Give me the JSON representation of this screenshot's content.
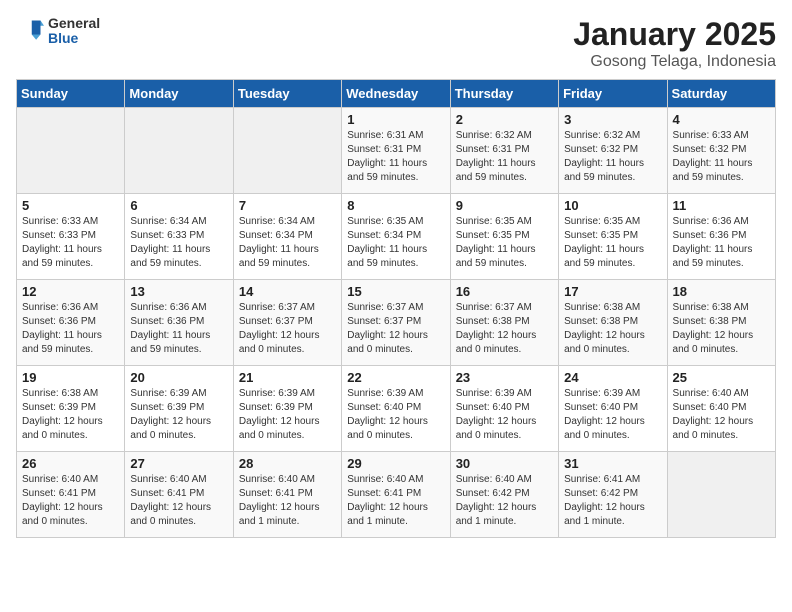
{
  "logo": {
    "general": "General",
    "blue": "Blue"
  },
  "title": "January 2025",
  "subtitle": "Gosong Telaga, Indonesia",
  "days_of_week": [
    "Sunday",
    "Monday",
    "Tuesday",
    "Wednesday",
    "Thursday",
    "Friday",
    "Saturday"
  ],
  "weeks": [
    [
      {
        "day": "",
        "info": ""
      },
      {
        "day": "",
        "info": ""
      },
      {
        "day": "",
        "info": ""
      },
      {
        "day": "1",
        "info": "Sunrise: 6:31 AM\nSunset: 6:31 PM\nDaylight: 11 hours\nand 59 minutes."
      },
      {
        "day": "2",
        "info": "Sunrise: 6:32 AM\nSunset: 6:31 PM\nDaylight: 11 hours\nand 59 minutes."
      },
      {
        "day": "3",
        "info": "Sunrise: 6:32 AM\nSunset: 6:32 PM\nDaylight: 11 hours\nand 59 minutes."
      },
      {
        "day": "4",
        "info": "Sunrise: 6:33 AM\nSunset: 6:32 PM\nDaylight: 11 hours\nand 59 minutes."
      }
    ],
    [
      {
        "day": "5",
        "info": "Sunrise: 6:33 AM\nSunset: 6:33 PM\nDaylight: 11 hours\nand 59 minutes."
      },
      {
        "day": "6",
        "info": "Sunrise: 6:34 AM\nSunset: 6:33 PM\nDaylight: 11 hours\nand 59 minutes."
      },
      {
        "day": "7",
        "info": "Sunrise: 6:34 AM\nSunset: 6:34 PM\nDaylight: 11 hours\nand 59 minutes."
      },
      {
        "day": "8",
        "info": "Sunrise: 6:35 AM\nSunset: 6:34 PM\nDaylight: 11 hours\nand 59 minutes."
      },
      {
        "day": "9",
        "info": "Sunrise: 6:35 AM\nSunset: 6:35 PM\nDaylight: 11 hours\nand 59 minutes."
      },
      {
        "day": "10",
        "info": "Sunrise: 6:35 AM\nSunset: 6:35 PM\nDaylight: 11 hours\nand 59 minutes."
      },
      {
        "day": "11",
        "info": "Sunrise: 6:36 AM\nSunset: 6:36 PM\nDaylight: 11 hours\nand 59 minutes."
      }
    ],
    [
      {
        "day": "12",
        "info": "Sunrise: 6:36 AM\nSunset: 6:36 PM\nDaylight: 11 hours\nand 59 minutes."
      },
      {
        "day": "13",
        "info": "Sunrise: 6:36 AM\nSunset: 6:36 PM\nDaylight: 11 hours\nand 59 minutes."
      },
      {
        "day": "14",
        "info": "Sunrise: 6:37 AM\nSunset: 6:37 PM\nDaylight: 12 hours\nand 0 minutes."
      },
      {
        "day": "15",
        "info": "Sunrise: 6:37 AM\nSunset: 6:37 PM\nDaylight: 12 hours\nand 0 minutes."
      },
      {
        "day": "16",
        "info": "Sunrise: 6:37 AM\nSunset: 6:38 PM\nDaylight: 12 hours\nand 0 minutes."
      },
      {
        "day": "17",
        "info": "Sunrise: 6:38 AM\nSunset: 6:38 PM\nDaylight: 12 hours\nand 0 minutes."
      },
      {
        "day": "18",
        "info": "Sunrise: 6:38 AM\nSunset: 6:38 PM\nDaylight: 12 hours\nand 0 minutes."
      }
    ],
    [
      {
        "day": "19",
        "info": "Sunrise: 6:38 AM\nSunset: 6:39 PM\nDaylight: 12 hours\nand 0 minutes."
      },
      {
        "day": "20",
        "info": "Sunrise: 6:39 AM\nSunset: 6:39 PM\nDaylight: 12 hours\nand 0 minutes."
      },
      {
        "day": "21",
        "info": "Sunrise: 6:39 AM\nSunset: 6:39 PM\nDaylight: 12 hours\nand 0 minutes."
      },
      {
        "day": "22",
        "info": "Sunrise: 6:39 AM\nSunset: 6:40 PM\nDaylight: 12 hours\nand 0 minutes."
      },
      {
        "day": "23",
        "info": "Sunrise: 6:39 AM\nSunset: 6:40 PM\nDaylight: 12 hours\nand 0 minutes."
      },
      {
        "day": "24",
        "info": "Sunrise: 6:39 AM\nSunset: 6:40 PM\nDaylight: 12 hours\nand 0 minutes."
      },
      {
        "day": "25",
        "info": "Sunrise: 6:40 AM\nSunset: 6:40 PM\nDaylight: 12 hours\nand 0 minutes."
      }
    ],
    [
      {
        "day": "26",
        "info": "Sunrise: 6:40 AM\nSunset: 6:41 PM\nDaylight: 12 hours\nand 0 minutes."
      },
      {
        "day": "27",
        "info": "Sunrise: 6:40 AM\nSunset: 6:41 PM\nDaylight: 12 hours\nand 0 minutes."
      },
      {
        "day": "28",
        "info": "Sunrise: 6:40 AM\nSunset: 6:41 PM\nDaylight: 12 hours\nand 1 minute."
      },
      {
        "day": "29",
        "info": "Sunrise: 6:40 AM\nSunset: 6:41 PM\nDaylight: 12 hours\nand 1 minute."
      },
      {
        "day": "30",
        "info": "Sunrise: 6:40 AM\nSunset: 6:42 PM\nDaylight: 12 hours\nand 1 minute."
      },
      {
        "day": "31",
        "info": "Sunrise: 6:41 AM\nSunset: 6:42 PM\nDaylight: 12 hours\nand 1 minute."
      },
      {
        "day": "",
        "info": ""
      }
    ]
  ]
}
